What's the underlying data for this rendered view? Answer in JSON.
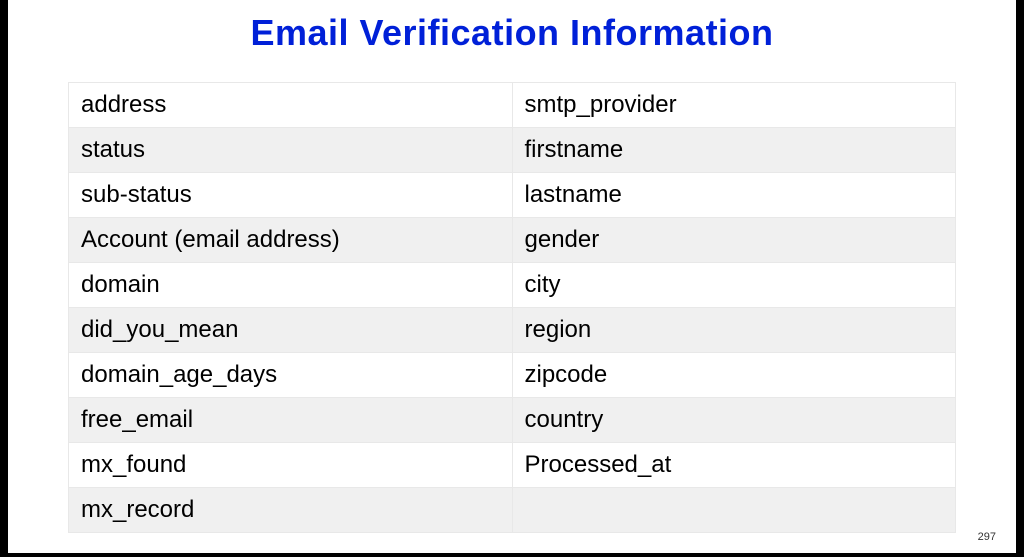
{
  "title": "Email Verification Information",
  "table": {
    "rows": [
      {
        "left": "address",
        "right": "smtp_provider"
      },
      {
        "left": "status",
        "right": "firstname"
      },
      {
        "left": "sub-status",
        "right": "lastname"
      },
      {
        "left": "Account (email address)",
        "right": "gender"
      },
      {
        "left": "domain",
        "right": "city"
      },
      {
        "left": "did_you_mean",
        "right": "region"
      },
      {
        "left": "domain_age_days",
        "right": "zipcode"
      },
      {
        "left": "free_email",
        "right": "country"
      },
      {
        "left": "mx_found",
        "right": "Processed_at"
      },
      {
        "left": "mx_record",
        "right": ""
      }
    ]
  },
  "page_number": "297"
}
